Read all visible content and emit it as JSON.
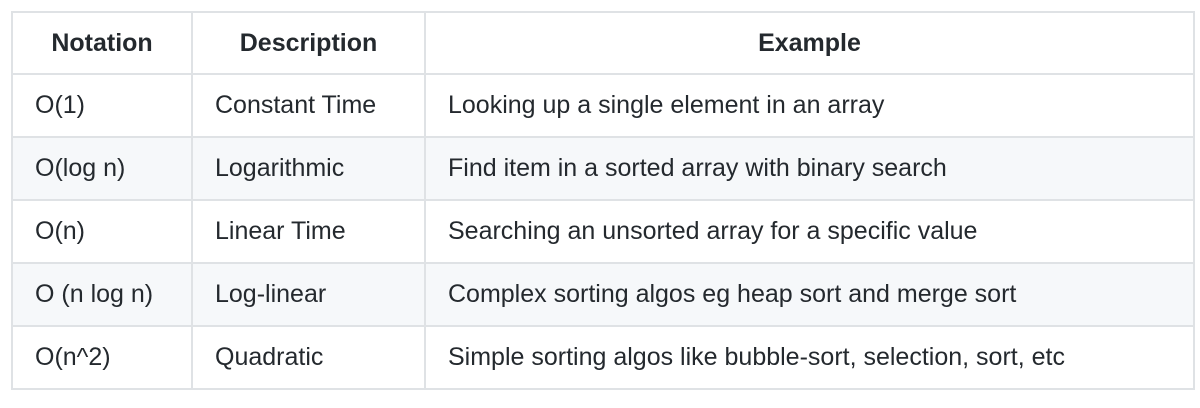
{
  "table": {
    "headers": [
      "Notation",
      "Description",
      "Example"
    ],
    "rows": [
      [
        "O(1)",
        "Constant Time",
        "Looking up a single element in an array"
      ],
      [
        "O(log n)",
        "Logarithmic",
        "Find item in a sorted array with binary search"
      ],
      [
        "O(n)",
        "Linear Time",
        "Searching an unsorted array for a specific value"
      ],
      [
        "O (n log n)",
        "Log-linear",
        "Complex sorting algos eg heap sort and merge sort"
      ],
      [
        "O(n^2)",
        "Quadratic",
        "Simple sorting algos like bubble-sort, selection, sort, etc"
      ]
    ]
  },
  "colors": {
    "border": "#dfe2e5",
    "stripe": "#f6f8fa",
    "text": "#24292e"
  }
}
